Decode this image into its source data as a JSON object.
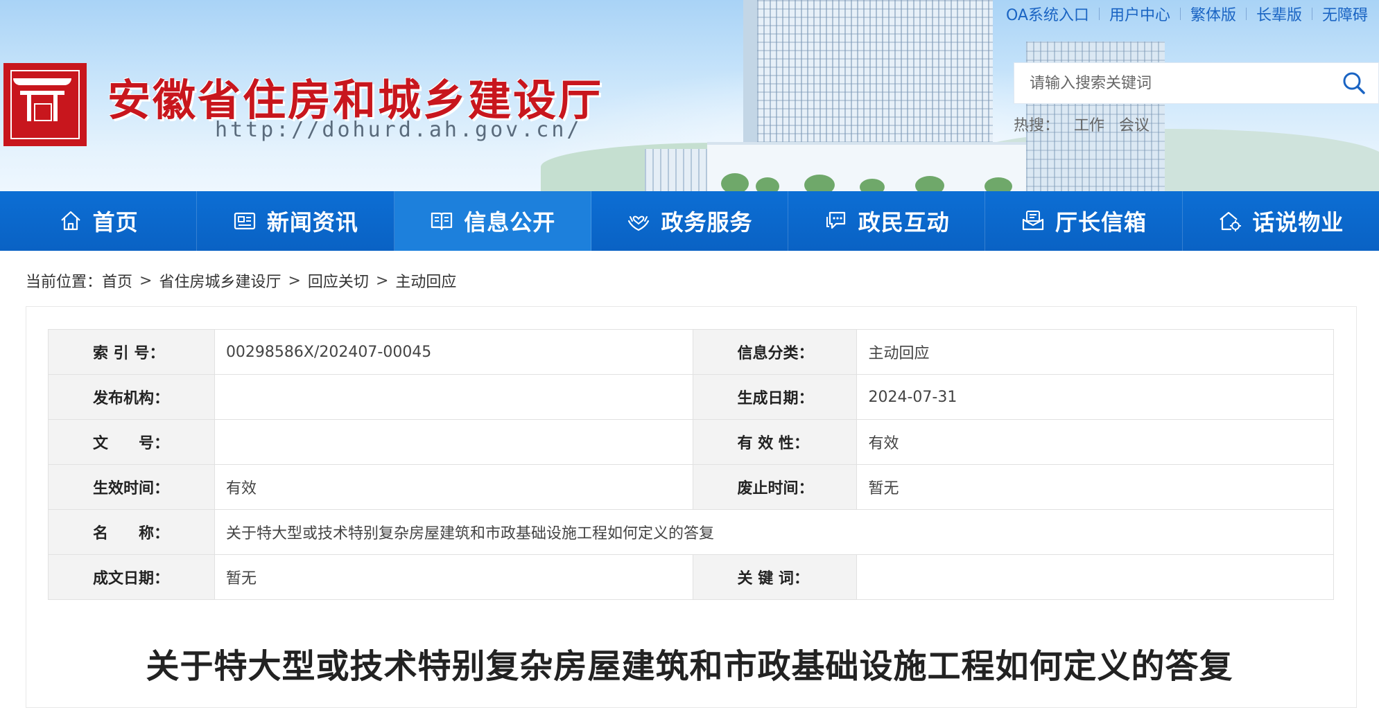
{
  "header": {
    "site_title": "安徽省住房和城乡建设厅",
    "site_url": "http://dohurd.ah.gov.cn/",
    "top_links": [
      "OA系统入口",
      "用户中心",
      "繁体版",
      "长辈版",
      "无障碍"
    ],
    "search": {
      "placeholder": "请输入搜索关键词"
    },
    "hot_search": {
      "label": "热搜：",
      "items": [
        "工作",
        "会议"
      ]
    },
    "colors": {
      "brand_red": "#c8161d",
      "link_blue": "#1a64c3"
    }
  },
  "nav": {
    "items": [
      {
        "label": "首页",
        "icon": "home-icon"
      },
      {
        "label": "新闻资讯",
        "icon": "newspaper-icon"
      },
      {
        "label": "信息公开",
        "icon": "open-book-icon"
      },
      {
        "label": "政务服务",
        "icon": "hands-heart-icon"
      },
      {
        "label": "政民互动",
        "icon": "chat-bubble-icon"
      },
      {
        "label": "厅长信箱",
        "icon": "mailbox-icon"
      },
      {
        "label": "话说物业",
        "icon": "house-gear-icon"
      }
    ],
    "active_index": 2,
    "colors": {
      "bar": "#0a62c4",
      "active": "#1d80dc"
    }
  },
  "breadcrumb": {
    "label": "当前位置：",
    "items": [
      "首页",
      "省住房城乡建设厅",
      "回应关切",
      "主动回应"
    ],
    "separator": ">"
  },
  "meta": {
    "rows": [
      {
        "l1": "索 引 号：",
        "v1": "00298586X/202407-00045",
        "l2": "信息分类：",
        "v2": "主动回应"
      },
      {
        "l1": "发布机构：",
        "v1": "",
        "l2": "生成日期：",
        "v2": "2024-07-31"
      },
      {
        "l1": "文　　号：",
        "v1": "",
        "l2": "有 效 性：",
        "v2": "有效"
      },
      {
        "l1": "生效时间：",
        "v1": "有效",
        "l2": "废止时间：",
        "v2": "暂无"
      },
      {
        "l1": "名　　称：",
        "v1": "关于特大型或技术特别复杂房屋建筑和市政基础设施工程如何定义的答复"
      },
      {
        "l1": "成文日期：",
        "v1": "暂无",
        "l2": "关 键 词：",
        "v2": ""
      }
    ]
  },
  "article": {
    "title": "关于特大型或技术特别复杂房屋建筑和市政基础设施工程如何定义的答复"
  }
}
